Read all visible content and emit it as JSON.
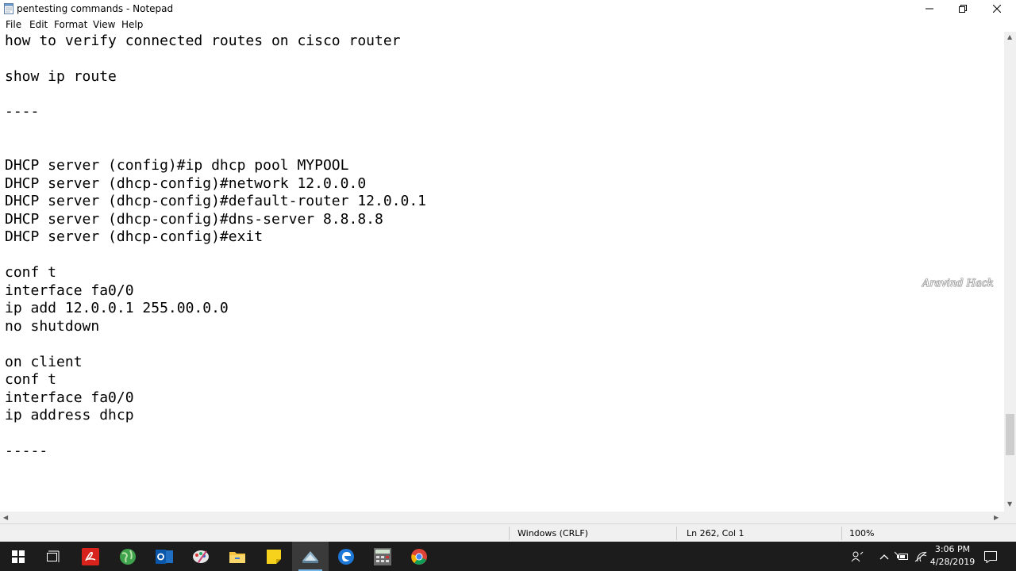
{
  "window": {
    "title": "pentesting commands - Notepad",
    "icon": "notepad-icon",
    "controls": [
      "minimize-icon",
      "restore-icon",
      "close-icon"
    ]
  },
  "menu": {
    "file": "File",
    "edit": "Edit",
    "format": "Format",
    "view": "View",
    "help": "Help"
  },
  "editor": {
    "lines": [
      "how to verify connected routes on cisco router",
      "show ip route",
      "----",
      "DHCP server (config)#ip dhcp pool MYPOOL",
      "DHCP server (dhcp-config)#network 12.0.0.0",
      "DHCP server (dhcp-config)#default-router 12.0.0.1",
      "DHCP server (dhcp-config)#dns-server 8.8.8.8",
      "DHCP server (dhcp-config)#exit",
      "conf t",
      "interface fa0/0",
      "ip add 12.0.0.1 255.00.0.0",
      "no shutdown",
      "on client",
      "conf t",
      "interface fa0/0",
      "ip address dhcp",
      "-----"
    ]
  },
  "watermark": "Aravind Hack",
  "status": {
    "line_ending": "Windows (CRLF)",
    "position": "Ln 262, Col 1",
    "zoom": "100%"
  },
  "taskbar": {
    "apps": [
      "windows-start-icon",
      "task-view-icon",
      "acrobat-icon",
      "globe-icon",
      "outlook-icon",
      "paint-icon",
      "file-explorer-icon",
      "sticky-notes-icon",
      "packet-tracer-icon",
      "edge-icon",
      "calculator-icon",
      "chrome-icon"
    ],
    "tray_icons": [
      "people-icon",
      "show-hidden-icons-chevron",
      "power-icon",
      "wifi-icon",
      "notification-center-icon"
    ],
    "time": "3:06 PM",
    "date": "4/28/2019"
  },
  "colors": {
    "taskbar": "#1c1c1c",
    "active_accent": "#76b9ed",
    "statusbar": "#f0f0f0"
  }
}
